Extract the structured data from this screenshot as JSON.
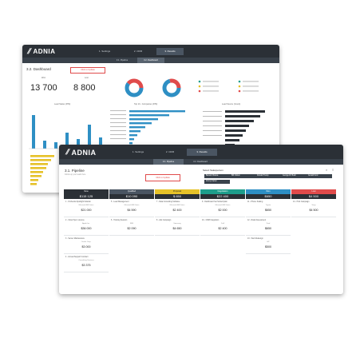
{
  "back": {
    "logo": "ADNIA",
    "nav": [
      "1. Settings",
      "2. CRM",
      "3. Results"
    ],
    "subtabs": [
      "3.1. Pipeline",
      "3.2. Dashboard"
    ],
    "title": "3.2. Dashboard",
    "button": "Click to Update",
    "kpis": [
      {
        "label": "Won",
        "value": "13 700"
      },
      {
        "label": "Lost",
        "value": "8 800"
      }
    ],
    "charts": {
      "lead": "Lead Status (P/M)",
      "top": "Top 10 - Companies (P/M)",
      "source": "Lead Source (Count)"
    }
  },
  "front": {
    "logo": "ADNIA",
    "nav": [
      "1. Settings",
      "2. CRM",
      "3. Results"
    ],
    "subtabs": [
      "3.1. Pipeline",
      "3.2. Dashboard"
    ],
    "title": "3.1. Pipeline",
    "subtitle": "Follow up your leads here",
    "button": "Click to Update",
    "select_title": "Select Salesperson",
    "salespeople": [
      "Barack Obama",
      "Bill Clinton",
      "Donald Trump",
      "George W. Bush",
      "Gerald Ford",
      "Jimmy Carter"
    ],
    "stages": [
      {
        "name": "New",
        "total": "$115 125",
        "color": "#2b3036"
      },
      {
        "name": "Qualified",
        "total": "$10 090",
        "color": "#4a5562"
      },
      {
        "name": "Proposal",
        "total": "$ 650",
        "color": "#e6c229"
      },
      {
        "name": "Negotiation",
        "total": "$22 400",
        "color": "#1e9e8c"
      },
      {
        "name": "Won",
        "total": "$650",
        "color": "#2e8fc4"
      },
      {
        "name": "Lost",
        "total": "$4 500",
        "color": "#e04b4b"
      }
    ],
    "cards": [
      [
        {
          "title": "1 - Orchestra Spotlight Solution",
          "sub": "Microsoft Bill Gates",
          "value": "$21 000"
        },
        {
          "title": "2 - Cloud Sync Licence",
          "sub": "Apple Inc.",
          "value": "$36 000"
        },
        {
          "title": "3 - Server Maintenance",
          "sub": "Oracle Corp.",
          "value": "$3 000"
        },
        {
          "title": "4 - Annual Support Contract",
          "sub": "Consulting Services",
          "value": "$3 375"
        }
      ],
      [
        {
          "title": "5 - Lead Management",
          "sub": "Microsoft Bill Gates",
          "value": "$4 590"
        },
        {
          "title": "6 - Training Session",
          "sub": "IBM",
          "value": "$2 090"
        }
      ],
      [
        {
          "title": "7 - Data Consulting Software",
          "sub": "Microsoft Bill Gates",
          "value": "$2 400"
        },
        {
          "title": "8 - Ads Campaign",
          "sub": "Samsung",
          "value": "$4 650"
        }
      ],
      [
        {
          "title": "9 - Dashboard Set Subscription",
          "sub": "Microsoft Bill Gates",
          "value": "$2 000"
        },
        {
          "title": "10 - CRM Integration",
          "sub": "Dell",
          "value": "$2 400"
        }
      ],
      [
        {
          "title": "11 - Phone Scaling",
          "sub": "Toyota",
          "value": "$650"
        },
        {
          "title": "12 - Road Assessment",
          "sub": "Ford",
          "value": "$650"
        },
        {
          "title": "13 - Web Redesign",
          "sub": "HP",
          "value": "$500"
        }
      ],
      [
        {
          "title": "14 - Print Campaign",
          "sub": "Sony",
          "value": "$4 500"
        }
      ]
    ]
  }
}
